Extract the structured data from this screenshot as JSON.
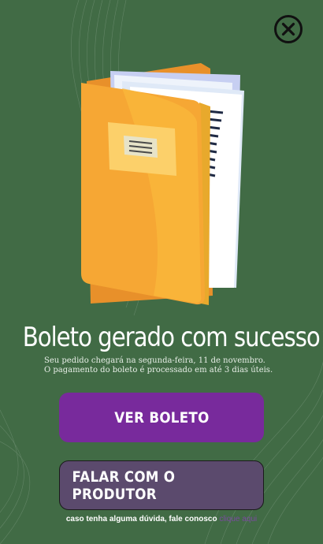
{
  "close": {
    "icon": "close-circle-icon"
  },
  "illustration": {
    "icon": "folder-documents-illustration"
  },
  "headline": "Boleto gerado com sucesso!",
  "subtext": {
    "line1": "Seu pedido chegará na segunda-feira, 11 de novembro.",
    "line2": "O pagamento do boleto é processado em até 3 dias úteis."
  },
  "buttons": {
    "primary_label": "VER BOLETO",
    "secondary_label": "FALAR COM O PRODUTOR"
  },
  "footer": {
    "text": "caso tenha alguma dúvida, fale conosco",
    "link": "clique aqui"
  },
  "colors": {
    "background": "#416b45",
    "primary_button": "#782a9c",
    "secondary_button": "#5b4a6d",
    "folder": "#f6a734"
  }
}
